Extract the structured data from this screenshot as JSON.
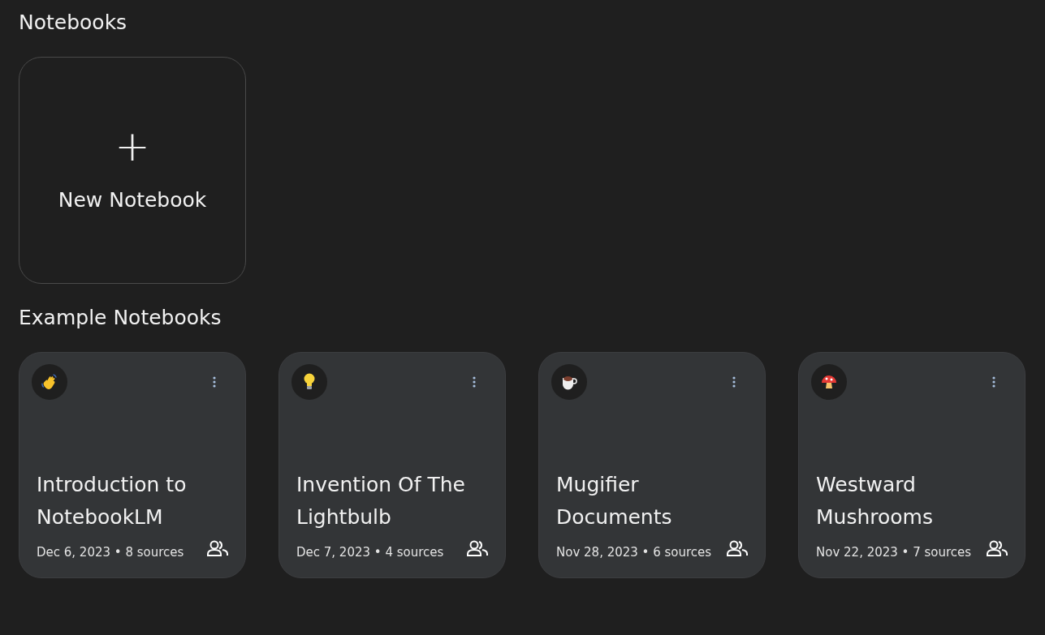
{
  "sections": [
    {
      "title": "Notebooks"
    }
  ],
  "new_notebook": {
    "plus": "+",
    "label": "New Notebook"
  },
  "examples": {
    "title": "Example Notebooks",
    "cards": [
      {
        "kind": "hand",
        "title": "Introduction to NotebookLM",
        "meta": "Dec 6, 2023 • 8 sources",
        "shared": true
      },
      {
        "kind": "bulb",
        "title": "Invention Of The Lightbulb",
        "meta": "Dec 7, 2023 • 4 sources",
        "shared": true
      },
      {
        "kind": "coffee",
        "title": "Mugifier Documents",
        "meta": "Nov 28, 2023 • 6 sources",
        "shared": true
      },
      {
        "kind": "mushroom",
        "title": "Westward Mushrooms",
        "meta": "Nov 22, 2023 • 7 sources",
        "shared": true
      }
    ]
  }
}
